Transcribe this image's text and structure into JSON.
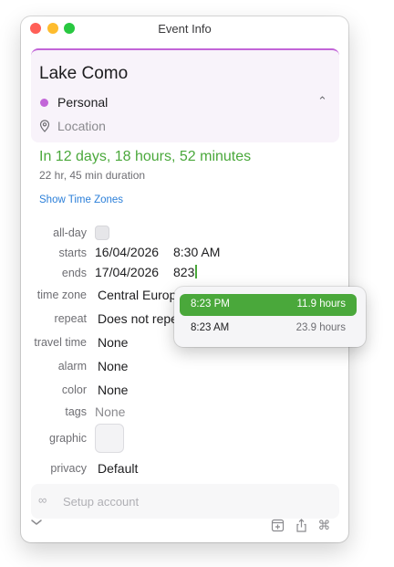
{
  "window": {
    "title": "Event Info"
  },
  "event": {
    "title": "Lake Como",
    "calendar": {
      "name": "Personal",
      "color": "#c265d8"
    },
    "location_placeholder": "Location"
  },
  "countdown": "In 12 days, 18 hours, 52 minutes",
  "duration": "22 hr, 45 min duration",
  "show_time_zones": "Show Time Zones",
  "fields": {
    "all_day": {
      "label": "all-day",
      "checked": false
    },
    "starts": {
      "label": "starts",
      "date": "16/04/2026",
      "time": "8:30 AM"
    },
    "ends": {
      "label": "ends",
      "date": "17/04/2026",
      "time_input": "823"
    },
    "time_zone": {
      "label": "time zone",
      "value": "Central Europ"
    },
    "repeat": {
      "label": "repeat",
      "value": "Does not repe"
    },
    "travel_time": {
      "label": "travel time",
      "value": "None"
    },
    "alarm": {
      "label": "alarm",
      "value": "None"
    },
    "color": {
      "label": "color",
      "value": "None"
    },
    "tags": {
      "label": "tags",
      "value": "None"
    },
    "graphic": {
      "label": "graphic"
    },
    "privacy": {
      "label": "privacy",
      "value": "Default"
    }
  },
  "time_suggestions": [
    {
      "time": "8:23 PM",
      "duration": "11.9 hours",
      "selected": true
    },
    {
      "time": "8:23 AM",
      "duration": "23.9 hours",
      "selected": false
    }
  ],
  "setup_account": {
    "label": "Setup account",
    "icon": "infinity-icon"
  },
  "bottom_bar": {
    "icons": [
      "chevron-down-icon",
      "add-to-calendar-icon",
      "share-icon",
      "command-icon"
    ]
  },
  "colors": {
    "accent_green": "#4aa83b",
    "link_blue": "#2b7fd9"
  }
}
